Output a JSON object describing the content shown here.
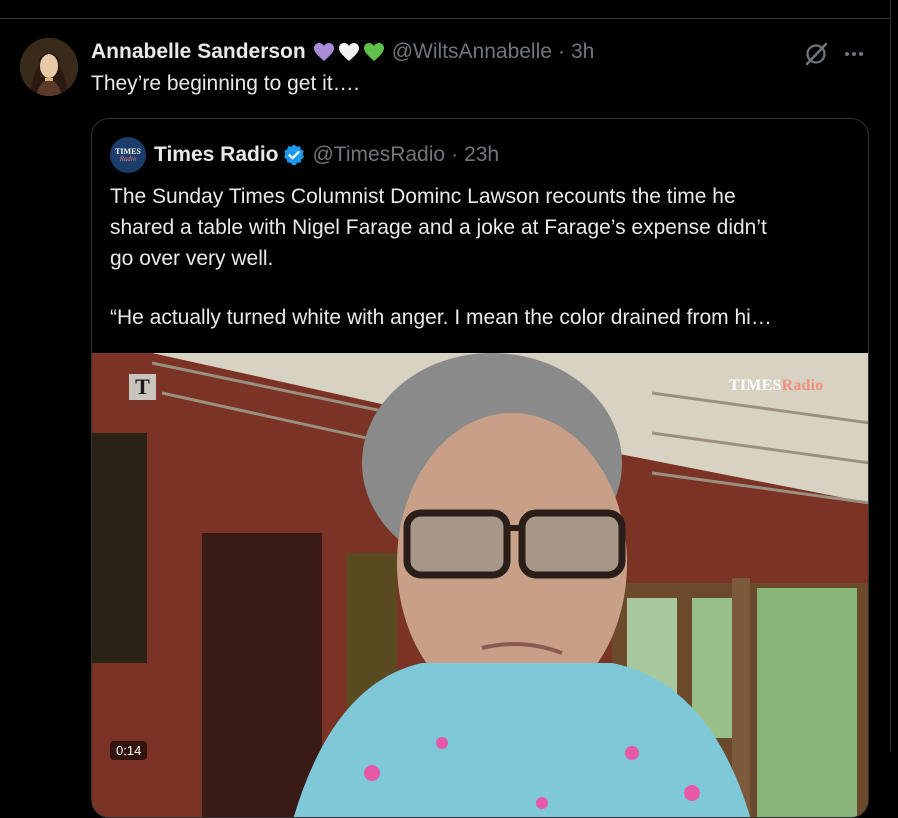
{
  "tweet": {
    "author_name": "Annabelle Sanderson",
    "author_handle": "@WiltsAnnabelle",
    "separator": "·",
    "time": "3h",
    "text": "They’re beginning to get it….",
    "hearts": [
      "purple-heart",
      "white-heart",
      "green-heart"
    ],
    "heart_colors": [
      "#a98bd8",
      "#f2f2f2",
      "#5fbf4a"
    ]
  },
  "quote": {
    "author_name": "Times Radio",
    "author_handle": "@TimesRadio",
    "separator": "·",
    "time": "23h",
    "avatar_line1": "TIMES",
    "avatar_line2": "Radio",
    "body_lines": [
      "The Sunday Times Columnist Dominc Lawson recounts the time he",
      "shared a table with Nigel Farage and a joke at Farage’s expense didn’t",
      "go over very well.",
      "“He actually turned white with anger. I mean the color drained from hi…"
    ],
    "media": {
      "t_logo": "T",
      "brand_times": "TIMES",
      "brand_radio": "Radio",
      "timer": "0:14"
    }
  },
  "colors": {
    "background": "#000000",
    "text_primary": "#e7e9ea",
    "text_secondary": "#71767b",
    "border": "#2f3336",
    "verified_blue": "#1d9bf0"
  }
}
